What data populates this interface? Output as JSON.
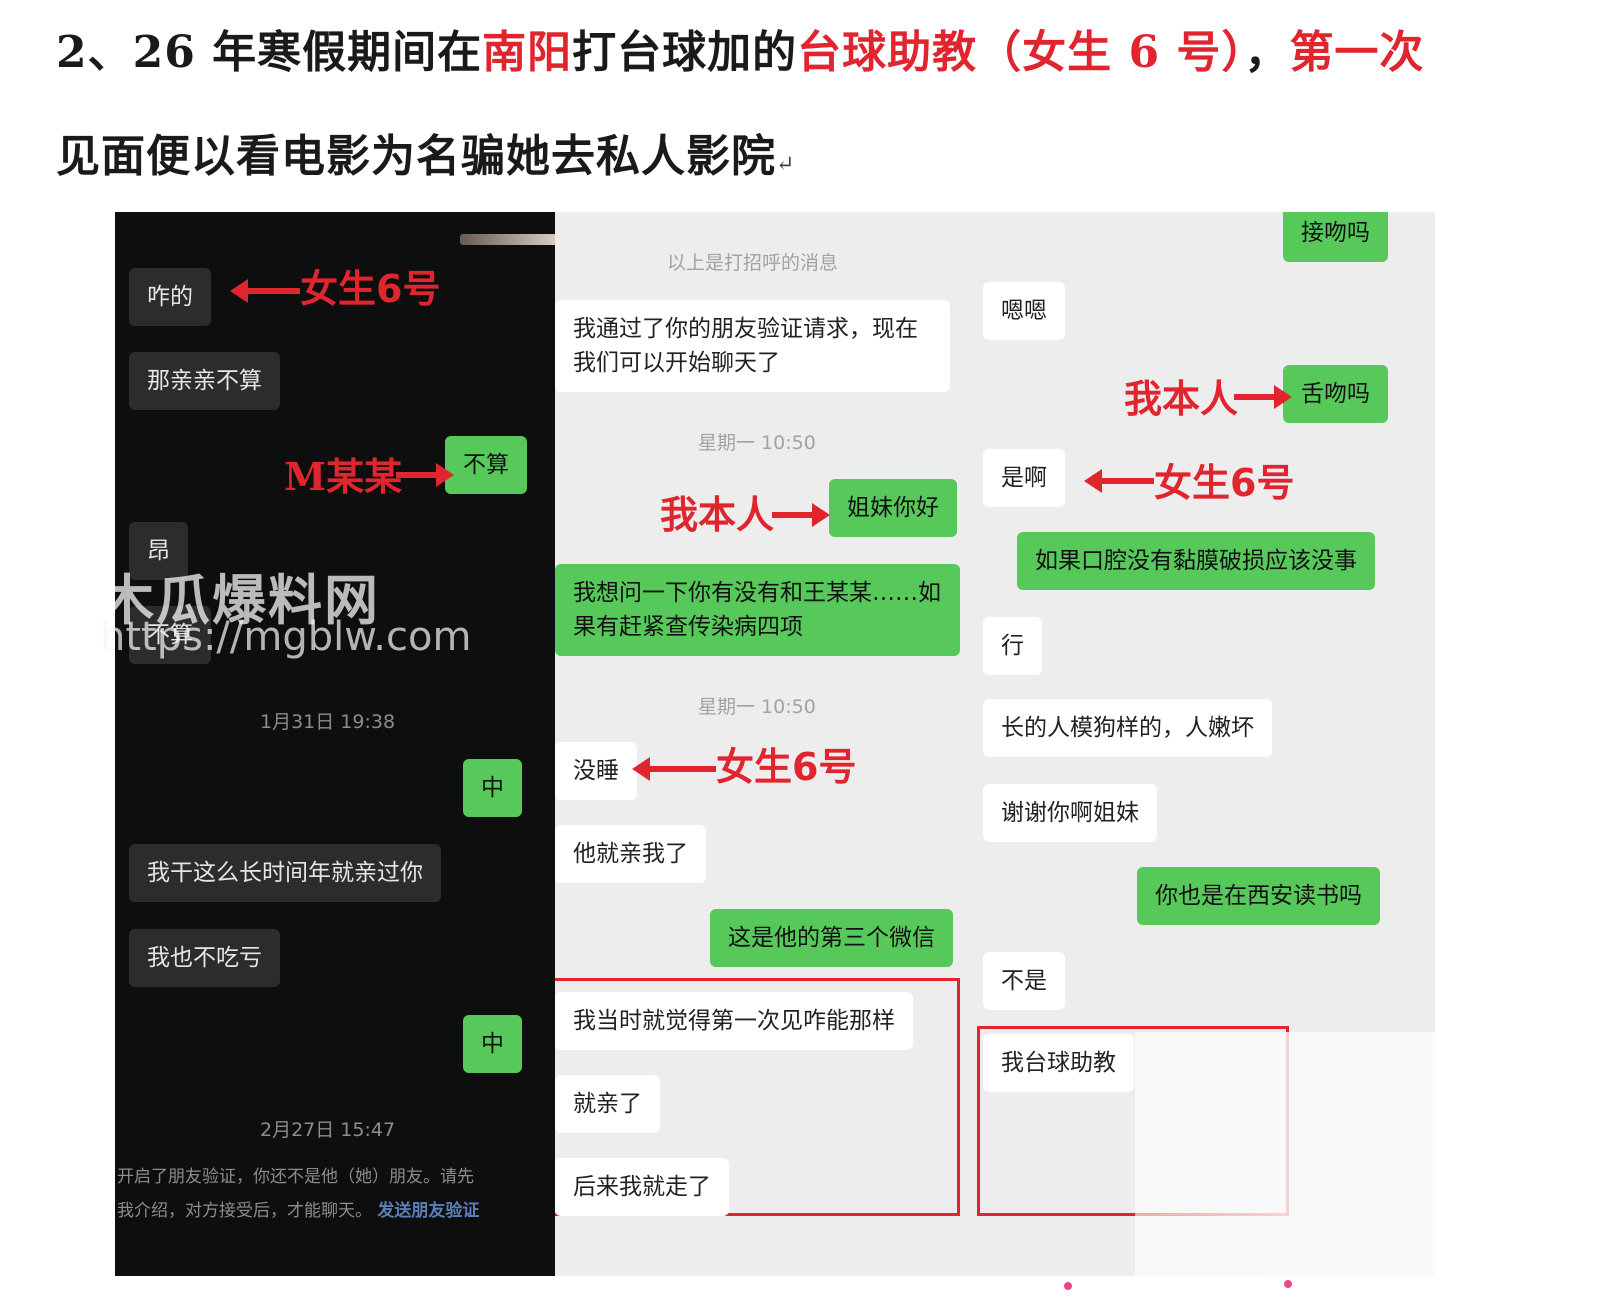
{
  "heading": {
    "line1": [
      {
        "text": "2、26 年寒假期间在",
        "color": "#1a1a1a"
      },
      {
        "text": "南阳",
        "color": "#e0252e"
      },
      {
        "text": "打台球加的",
        "color": "#1a1a1a"
      },
      {
        "text": "台球助教（女生 6 号）",
        "color": "#e0252e"
      },
      {
        "text": "，",
        "color": "#1a1a1a"
      },
      {
        "text": "第一次",
        "color": "#e0252e"
      }
    ],
    "line2": "见面便以看电影为名骗她去私人影院",
    "line2_mark": "↵"
  },
  "left_chat": {
    "bubble_zha": "咋的",
    "bubble_naqin": "那亲亲不算",
    "bubble_busuan": "不算",
    "bubble_ang": "昂",
    "bubble_busuan2": "不算",
    "time_1": "1月31日 19:38",
    "bubble_zhong1": "中",
    "bubble_wogan": "我干这么长时间年就亲过你",
    "bubble_wobuchi": "我也不吃亏",
    "bubble_zhong2": "中",
    "time_2": "2月27日 15:47",
    "note_line1": "开启了朋友验证，你还不是他（她）朋友。请先",
    "note_line2": "我介绍，对方接受后，才能聊天。",
    "note_link": "发送朋友验证"
  },
  "middle_chat": {
    "top_hint": "以上是打招呼的消息",
    "bubble_verify": "我通过了你的朋友验证请求，现在我们可以开始聊天了",
    "time_1": "星期一 10:50",
    "bubble_jiemei": "姐妹你好",
    "bubble_question": "我想问一下你有没有和王某某……如果有赶紧查传染病四项",
    "time_2": "星期一 10:50",
    "bubble_meishui": "没睡",
    "bubble_taqin": "他就亲我了",
    "bubble_disan": "这是他的第三个微信",
    "bubble_dangshi": "我当时就觉得第一次见咋能那样",
    "bubble_jiuqin": "就亲了",
    "bubble_houlai": "后来我就走了"
  },
  "right_chat": {
    "bubble_jiewen": "接吻吗",
    "bubble_enen": "嗯嗯",
    "bubble_shewen": "舌吻吗",
    "bubble_shia": "是啊",
    "bubble_kouqiang": "如果口腔没有黏膜破损应该没事",
    "bubble_xing": "行",
    "bubble_zhangde": "长的人模狗样的，人嫩坏",
    "bubble_xiexie": "谢谢你啊姐妹",
    "bubble_xian": "你也是在西安读书吗",
    "bubble_bushi": "不是",
    "bubble_zhujiao": "我台球助教"
  },
  "annotations": {
    "girl6": "女生6号",
    "mmoumou": "M某某",
    "myself": "我本人"
  },
  "watermark": {
    "title": "木瓜爆料网",
    "url": "https://mgblw.com"
  },
  "colors": {
    "accent_red": "#e0252e",
    "wechat_green": "#57c85a",
    "dark_bg": "#0e0e0e",
    "light_bg": "#ededed"
  }
}
